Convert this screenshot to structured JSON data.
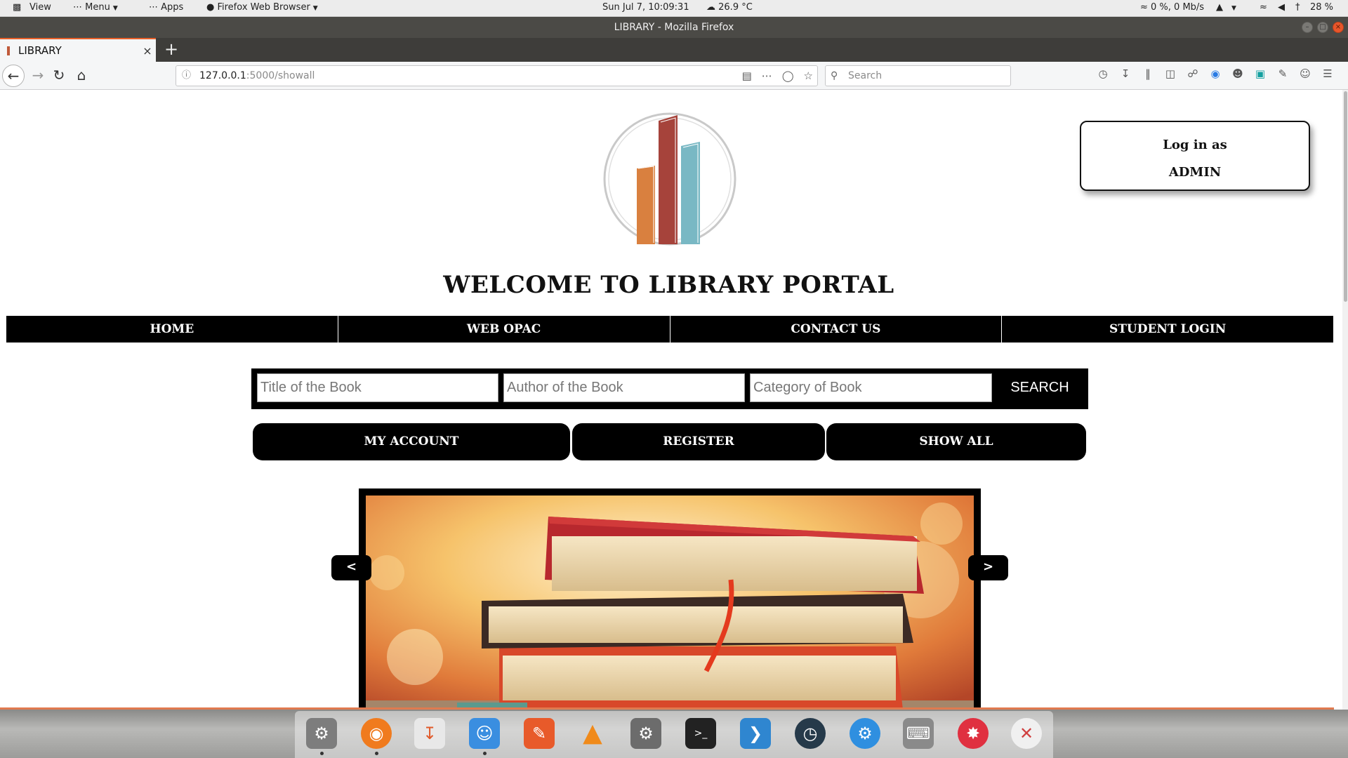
{
  "os_panel": {
    "view_label": "View",
    "menu_label": "Menu",
    "apps_label": "Apps",
    "active_app_label": "Firefox Web Browser",
    "clock": "Sun Jul  7, 10:09:31",
    "temperature": "26.9 °C",
    "network": "0 %, 0 Mb/s",
    "battery": "28 %"
  },
  "window": {
    "title": "LIBRARY - Mozilla Firefox"
  },
  "browser": {
    "tab_title": "LIBRARY",
    "url_host": "127.0.0.1",
    "url_path": ":5000/showall",
    "search_placeholder": "Search"
  },
  "page": {
    "admin_line1": "Log in as",
    "admin_line2": "ADMIN",
    "welcome": "WELCOME TO LIBRARY PORTAL",
    "nav": [
      "HOME",
      "WEB OPAC",
      "CONTACT US",
      "STUDENT LOGIN"
    ],
    "search": {
      "title_placeholder": "Title of the Book",
      "author_placeholder": "Author of the Book",
      "category_placeholder": "Category of Book",
      "button": "SEARCH"
    },
    "buttons": {
      "my_account": "MY ACCOUNT",
      "register": "REGISTER",
      "show_all": "SHOW ALL"
    },
    "slider": {
      "prev": "<",
      "next": ">"
    }
  },
  "colors": {
    "accent": "#e8612a",
    "page_bg": "#ffffff",
    "nav_bg": "#000000"
  },
  "dock_apps": [
    "system-settings-icon",
    "firefox-icon",
    "downloader-icon",
    "finder-icon",
    "gimp-icon",
    "vlc-icon",
    "settings-gear-icon",
    "terminal-icon",
    "vscode-icon",
    "stacer-icon",
    "preferences-icon",
    "keyboard-icon",
    "lifesaver-icon",
    "kodi-icon"
  ]
}
